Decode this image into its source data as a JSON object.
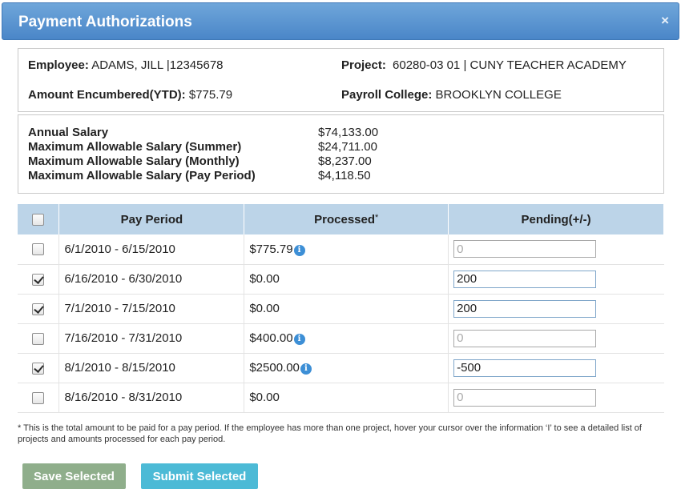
{
  "dialog": {
    "title": "Payment Authorizations",
    "close_glyph": "×"
  },
  "employee": {
    "employee_label": "Employee:",
    "employee_name": "ADAMS, JILL",
    "employee_id": "12345678",
    "encumbered_label": "Amount Encumbered(YTD):",
    "encumbered_value": "$775.79",
    "project_label": "Project:",
    "project_code": "60280-03 01",
    "project_name": "CUNY TEACHER ACADEMY",
    "college_label": "Payroll College:",
    "college_value": "BROOKLYN COLLEGE"
  },
  "salary": [
    {
      "label": "Annual Salary",
      "value": "$74,133.00"
    },
    {
      "label": "Maximum Allowable Salary (Summer)",
      "value": "$24,711.00"
    },
    {
      "label": "Maximum Allowable Salary (Monthly)",
      "value": "$8,237.00"
    },
    {
      "label": "Maximum Allowable Salary (Pay Period)",
      "value": "$4,118.50"
    }
  ],
  "table": {
    "headers": {
      "pay_period": "Pay Period",
      "processed": "Processed",
      "processed_marker": "*",
      "pending": "Pending(+/-)"
    },
    "header_checked": false,
    "rows": [
      {
        "checked": false,
        "period": "6/1/2010 - 6/15/2010",
        "processed": "$775.79",
        "info": true,
        "pending_value": "",
        "pending_placeholder": "0"
      },
      {
        "checked": true,
        "period": "6/16/2010 - 6/30/2010",
        "processed": "$0.00",
        "info": false,
        "pending_value": "200",
        "pending_placeholder": ""
      },
      {
        "checked": true,
        "period": "7/1/2010 - 7/15/2010",
        "processed": "$0.00",
        "info": false,
        "pending_value": "200",
        "pending_placeholder": ""
      },
      {
        "checked": false,
        "period": "7/16/2010 - 7/31/2010",
        "processed": "$400.00",
        "info": true,
        "pending_value": "",
        "pending_placeholder": "0"
      },
      {
        "checked": true,
        "period": "8/1/2010 - 8/15/2010",
        "processed": "$2500.00",
        "info": true,
        "pending_value": "-500",
        "pending_placeholder": ""
      },
      {
        "checked": false,
        "period": "8/16/2010 - 8/31/2010",
        "processed": "$0.00",
        "info": false,
        "pending_value": "",
        "pending_placeholder": "0"
      }
    ]
  },
  "footnote": "* This is the total amount to be paid for a pay period. If the employee has more than one project, hover your cursor over the information ‘I’ to see a detailed list of projects and amounts processed for each pay period.",
  "buttons": {
    "save_label": "Save Selected",
    "submit_label": "Submit Selected"
  },
  "icons": {
    "info": "i"
  },
  "colors": {
    "title_bar": "#4a86c8",
    "table_header": "#bcd4e8",
    "save_button": "#8fae8b",
    "submit_button": "#4cbad6",
    "info_icon": "#3d8fd6"
  }
}
